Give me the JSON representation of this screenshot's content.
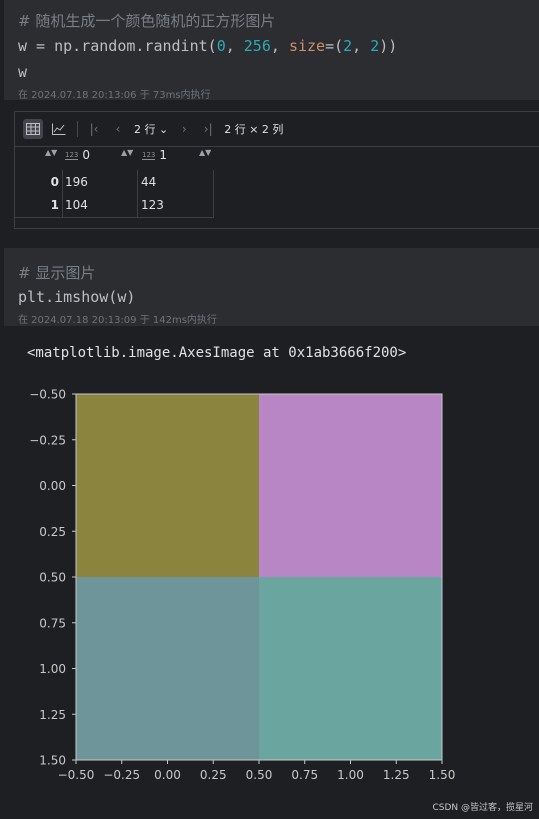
{
  "cell1": {
    "comment": "# 随机生成一个颜色随机的正方形图片",
    "code_prefix": "w = np.random.randint(",
    "arg0": "0",
    "comma1": ", ",
    "arg1": "256",
    "comma2": ", ",
    "param": "size",
    "eq": "=(",
    "arg2": "2",
    "comma3": ", ",
    "arg3": "2",
    "code_suffix": "))",
    "output_var": "w",
    "meta": "在 2024.07.18 20:13:06 于 73ms内执行"
  },
  "dataframe": {
    "rows_label": "2 行",
    "shape_label": "2 行 × 2 列",
    "columns": [
      "0",
      "1"
    ],
    "type_badge": "123",
    "rows": [
      {
        "index": "0",
        "values": [
          "196",
          "44"
        ]
      },
      {
        "index": "1",
        "values": [
          "104",
          "123"
        ]
      }
    ]
  },
  "cell2": {
    "comment": "# 显示图片",
    "code": "plt.imshow(w)",
    "meta": "在 2024.07.18 20:13:09 于 142ms内执行"
  },
  "output": {
    "repr": "<matplotlib.image.AxesImage at 0x1ab3666f200>"
  },
  "chart_data": {
    "type": "heatmap",
    "colormap": "viridis",
    "matrix": [
      [
        196,
        44
      ],
      [
        104,
        123
      ]
    ],
    "cell_colors": [
      [
        "#8a843f",
        "#b886c5"
      ],
      [
        "#6e9599",
        "#6aa69f"
      ]
    ],
    "x_ticks": [
      "−0.50",
      "−0.25",
      "0.00",
      "0.25",
      "0.50",
      "0.75",
      "1.00",
      "1.25",
      "1.50"
    ],
    "y_ticks": [
      "−0.50",
      "−0.25",
      "0.00",
      "0.25",
      "0.50",
      "0.75",
      "1.00",
      "1.25",
      "1.50"
    ],
    "xlim": [
      -0.5,
      1.5
    ],
    "ylim": [
      1.5,
      -0.5
    ],
    "grid": false
  },
  "watermark": "CSDN @皆过客，揽星河"
}
